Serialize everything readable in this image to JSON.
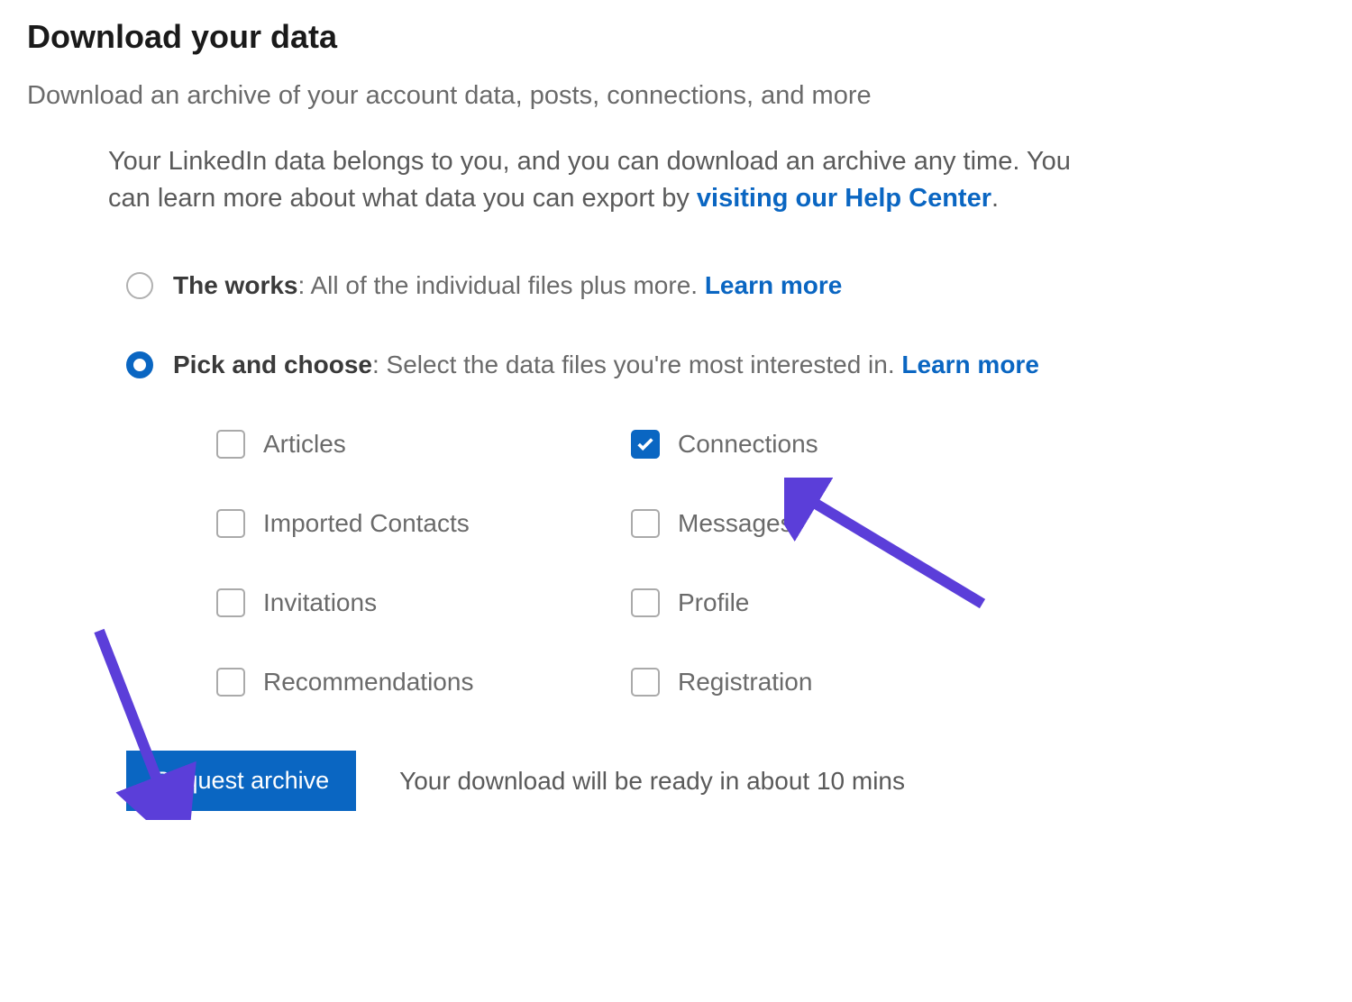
{
  "title": "Download your data",
  "subtitle": "Download an archive of your account data, posts, connections, and more",
  "intro": {
    "text_before_link": "Your LinkedIn data belongs to you, and you can download an archive any time. You can learn more about what data you can export by ",
    "link_text": "visiting our Help Center",
    "text_after_link": "."
  },
  "radios": {
    "works": {
      "bold": "The works",
      "desc": ": All of the individual files plus more. ",
      "learn_more": "Learn more",
      "selected": false
    },
    "pick": {
      "bold": "Pick and choose",
      "desc": ": Select the data files you're most interested in. ",
      "learn_more": "Learn more",
      "selected": true
    }
  },
  "checkboxes": [
    {
      "label": "Articles",
      "checked": false
    },
    {
      "label": "Connections",
      "checked": true
    },
    {
      "label": "Imported Contacts",
      "checked": false
    },
    {
      "label": "Messages",
      "checked": false
    },
    {
      "label": "Invitations",
      "checked": false
    },
    {
      "label": "Profile",
      "checked": false
    },
    {
      "label": "Recommendations",
      "checked": false
    },
    {
      "label": "Registration",
      "checked": false
    }
  ],
  "action": {
    "button": "Request archive",
    "status": "Your download will be ready in about 10 mins"
  },
  "colors": {
    "link": "#0a66c2",
    "arrow": "#5b3ed9"
  }
}
